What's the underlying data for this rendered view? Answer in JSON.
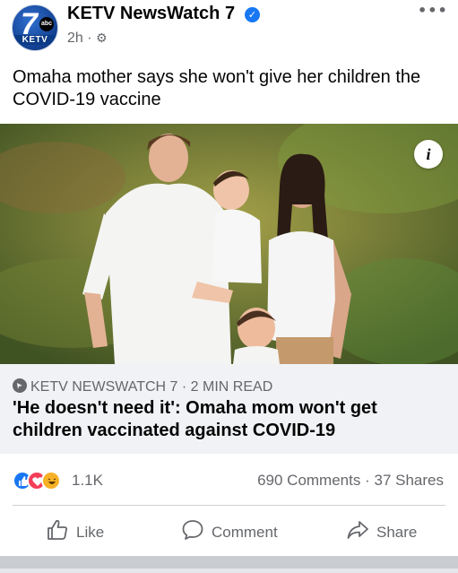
{
  "post": {
    "page_name": "KETV NewsWatch 7",
    "time": "2h",
    "separator": "·",
    "more_label": "•••",
    "caption": "Omaha mother says she won't give her children the COVID-19 vaccine",
    "avatar_text": {
      "number": "7",
      "network": "abc",
      "station": "KETV"
    }
  },
  "link": {
    "source": "KETV NEWSWATCH 7",
    "read_time": "2 MIN READ",
    "title": "'He doesn't need it': Omaha mom won't get children vaccinated against COVID-19"
  },
  "engagement": {
    "reactions": [
      "like",
      "love",
      "haha"
    ],
    "reaction_count": "1.1K",
    "comments": "690 Comments",
    "shares": "37 Shares",
    "dot": "·"
  },
  "actions": [
    {
      "label": "Like",
      "icon": "thumbs-up-icon"
    },
    {
      "label": "Comment",
      "icon": "speech-bubble-icon"
    },
    {
      "label": "Share",
      "icon": "share-arrow-icon"
    }
  ],
  "colors": {
    "brand_blue": "#1877f2",
    "love_red": "#f33e58",
    "haha_yellow": "#f7b125",
    "secondary_text": "#65676b"
  }
}
